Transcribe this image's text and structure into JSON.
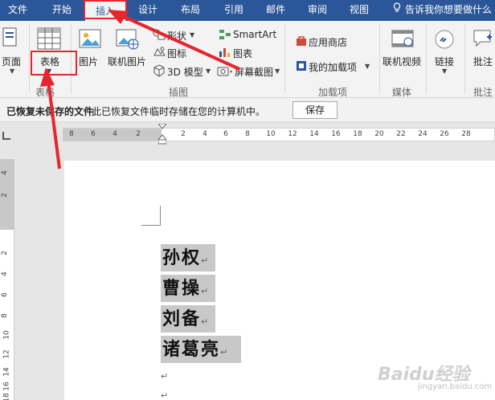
{
  "menu": {
    "tabs": [
      "文件",
      "开始",
      "插入",
      "设计",
      "布局",
      "引用",
      "邮件",
      "审阅",
      "视图"
    ],
    "active_tab": "插入",
    "tell_me": "告诉我你想要做什么"
  },
  "ribbon": {
    "page_label": "页面",
    "table_label": "表格",
    "table_group_label": "表格",
    "picture_label": "图片",
    "online_picture_label": "联机图片",
    "shapes_label": "形状",
    "icons_label": "图标",
    "model3d_label": "3D 模型",
    "smartart_label": "SmartArt",
    "chart_label": "图表",
    "screenshot_label": "屏幕截图",
    "illustrations_group_label": "插图",
    "store_label": "应用商店",
    "my_addins_label": "我的加载项",
    "addins_group_label": "加载项",
    "online_video_label": "联机视频",
    "media_group_label": "媒体",
    "link_label": "链接",
    "comment_label": "批注",
    "comment_group_label": "批注"
  },
  "notification": {
    "title": "已恢复未保存的文件",
    "message": "此已恢复文件临时存储在您的计算机中。",
    "save_button": "保存"
  },
  "ruler": {
    "h_ticks": [
      "8",
      "6",
      "4",
      "2",
      "2",
      "4",
      "6",
      "8",
      "10",
      "12",
      "14",
      "16",
      "18",
      "20",
      "22",
      "24",
      "26",
      "28"
    ],
    "v_ticks": [
      "4",
      "2",
      "2",
      "4",
      "6",
      "8",
      "10",
      "12",
      "14",
      "16",
      "18"
    ]
  },
  "document": {
    "lines": [
      "孙权",
      "曹操",
      "刘备",
      "诸葛亮"
    ],
    "para_mark": "↵"
  },
  "watermark": {
    "text": "Baidu经验",
    "sub": "jingyan.baidu.com"
  },
  "colors": {
    "title_bar": "#2b579a",
    "annotation_red": "#e8242c",
    "highlight": "#c8c8c8"
  }
}
